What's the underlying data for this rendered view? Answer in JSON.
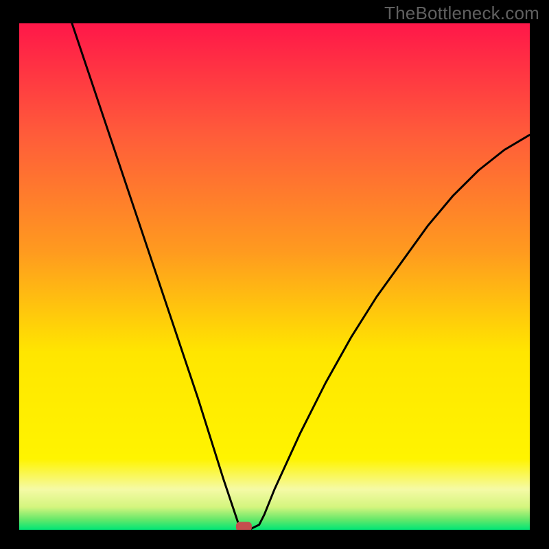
{
  "watermark": "TheBottleneck.com",
  "colors": {
    "frame": "#000000",
    "gradient_top": "#FF1749",
    "gradient_mid1": "#FF8A00",
    "gradient_mid2": "#FFE600",
    "gradient_band": "#F5FAA6",
    "gradient_bottom": "#00E676",
    "curve": "#000000",
    "marker": "#C54E4E"
  },
  "chart_data": {
    "type": "line",
    "title": "",
    "xlabel": "",
    "ylabel": "",
    "xlim": [
      0,
      100
    ],
    "ylim": [
      0,
      100
    ],
    "grid": false,
    "annotations": [],
    "marker": {
      "x": 44,
      "y": 0,
      "shape": "rounded-rect"
    },
    "series": [
      {
        "name": "curve",
        "x": [
          0,
          5,
          10,
          15,
          20,
          25,
          30,
          35,
          40,
          42,
          43,
          44,
          45,
          46,
          47,
          48,
          50,
          55,
          60,
          65,
          70,
          75,
          80,
          85,
          90,
          95,
          100
        ],
        "y": [
          133,
          117,
          101,
          86,
          71,
          56,
          41,
          26,
          10,
          4,
          1,
          0,
          0,
          0.5,
          1,
          3,
          8,
          19,
          29,
          38,
          46,
          53,
          60,
          66,
          71,
          75,
          78
        ]
      }
    ]
  }
}
